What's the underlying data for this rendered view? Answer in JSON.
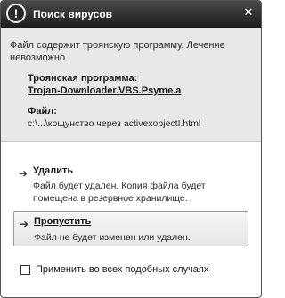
{
  "window": {
    "title": "Поиск вирусов",
    "title_icon": "!",
    "close_icon": "✕"
  },
  "info": {
    "message": "Файл содержит троянскую программу. Лечение невозможно",
    "threat_label": "Троянская программа:",
    "threat_name": "Trojan-Downloader.VBS.Psyme.a",
    "file_label": "Файл:",
    "file_path": "c:\\...\\кощунство через activexobject!.html"
  },
  "actions": [
    {
      "arrow": "➔",
      "title": "Удалить",
      "description": "Файл будет удален. Копия файла будет помещена в резервное хранилище."
    },
    {
      "arrow": "➔",
      "title": "Пропустить",
      "description": "Файл не будет изменен или удален."
    }
  ],
  "apply_all": {
    "label": "Применить во всех подобных случаях",
    "checked": false
  }
}
